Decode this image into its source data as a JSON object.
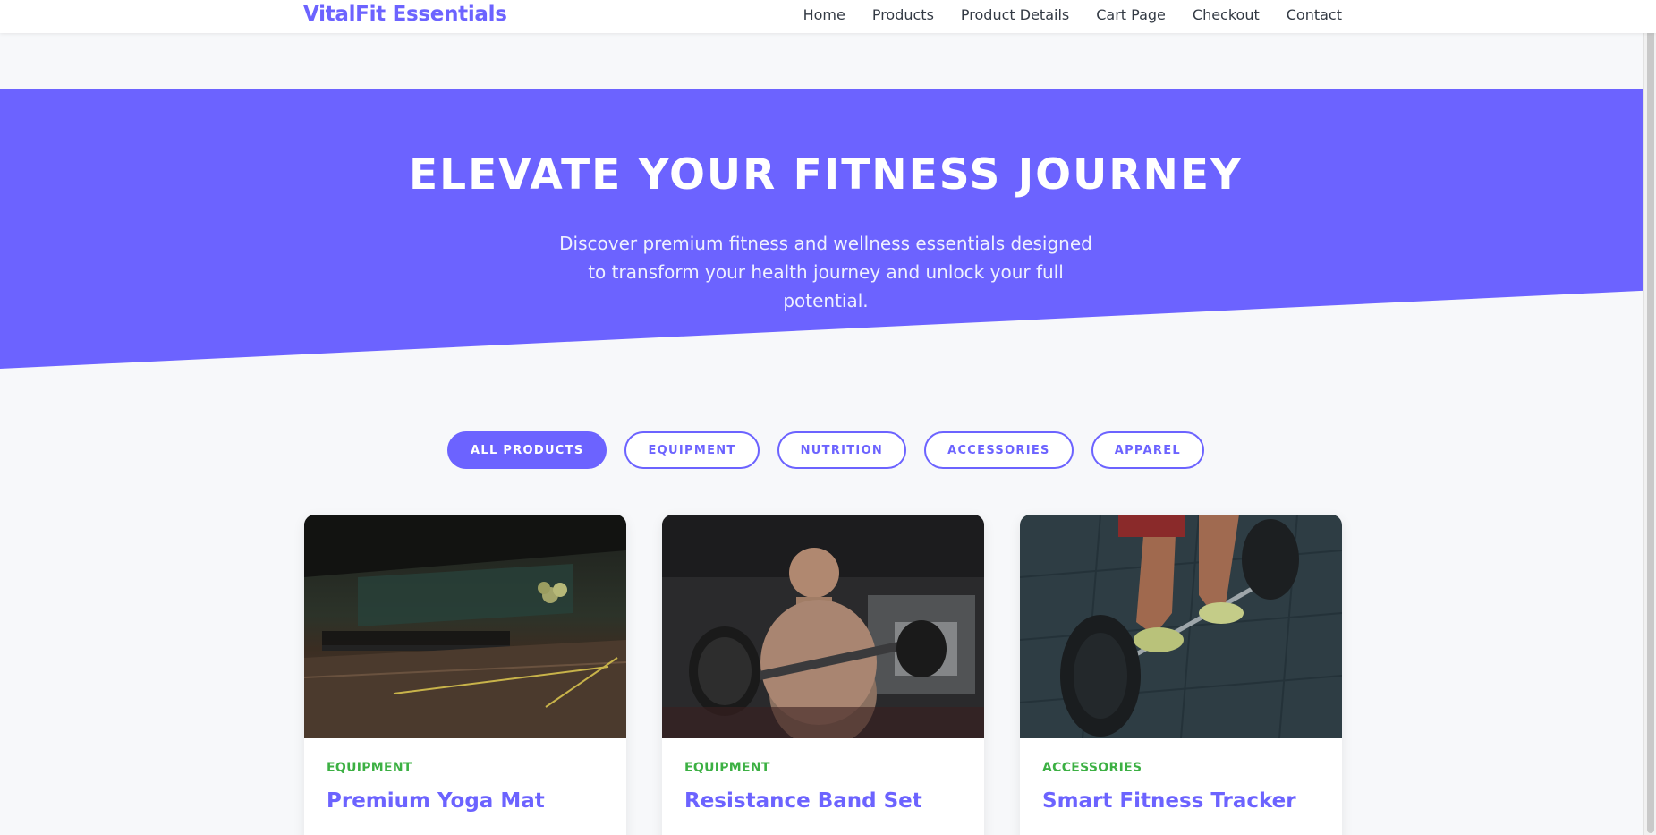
{
  "brand": "VitalFit Essentials",
  "nav": [
    "Home",
    "Products",
    "Product Details",
    "Cart Page",
    "Checkout",
    "Contact"
  ],
  "hero": {
    "title": "ELEVATE YOUR FITNESS JOURNEY",
    "subtitle": "Discover premium fitness and wellness essentials designed to transform your health journey and unlock your full potential."
  },
  "filters": [
    "ALL PRODUCTS",
    "EQUIPMENT",
    "NUTRITION",
    "ACCESSORIES",
    "APPAREL"
  ],
  "products": [
    {
      "category": "EQUIPMENT",
      "name": "Premium Yoga Mat"
    },
    {
      "category": "EQUIPMENT",
      "name": "Resistance Band Set"
    },
    {
      "category": "ACCESSORIES",
      "name": "Smart Fitness Tracker"
    }
  ],
  "colors": {
    "accent": "#6c63ff",
    "category": "#3cb043",
    "background": "#f7f8fa"
  }
}
